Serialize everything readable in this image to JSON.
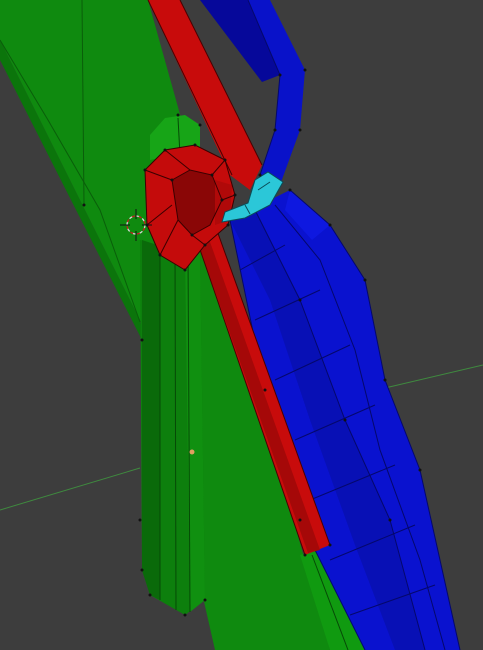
{
  "viewport": {
    "type": "3d-viewport",
    "background_color": "#3d3d3d",
    "grid_line_color": "#3f8a3f",
    "object_colors": {
      "green_mesh": "#0f8a0f",
      "green_mesh_dark": "#0a6e0a",
      "green_mesh_light": "#18a018",
      "red_mesh": "#c80b0b",
      "red_mesh_dark": "#8a0606",
      "blue_mesh": "#0a12cf",
      "blue_mesh_dark": "#06089a",
      "selected_faces": "#2bc7d8",
      "vertex_color": "#111111",
      "object_origin_color": "#e0a060",
      "cursor_color": "#d8d8d8"
    },
    "icons": [
      "3d-cursor-icon",
      "object-origin-icon"
    ]
  }
}
